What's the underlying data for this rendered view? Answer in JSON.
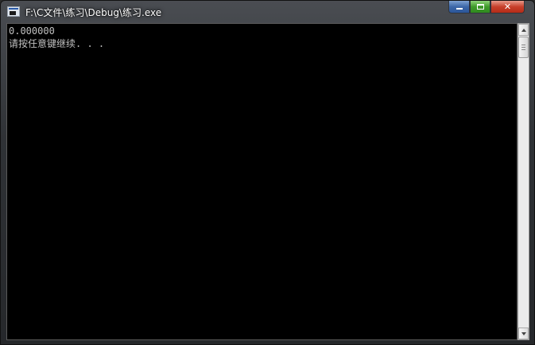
{
  "window": {
    "title": "F:\\C文件\\练习\\Debug\\练习.exe",
    "icon": "console-app-icon"
  },
  "caption_buttons": {
    "minimize": "minimize-icon",
    "maximize": "maximize-icon",
    "close": "close-icon",
    "close_glyph": "✕"
  },
  "console": {
    "lines": [
      "0.000000",
      "请按任意键继续. . ."
    ],
    "text_color": "#c0c0c0",
    "background": "#000000"
  },
  "colors": {
    "minimize": "#3d67a8",
    "maximize": "#3f9a2a",
    "close": "#c7402b"
  }
}
